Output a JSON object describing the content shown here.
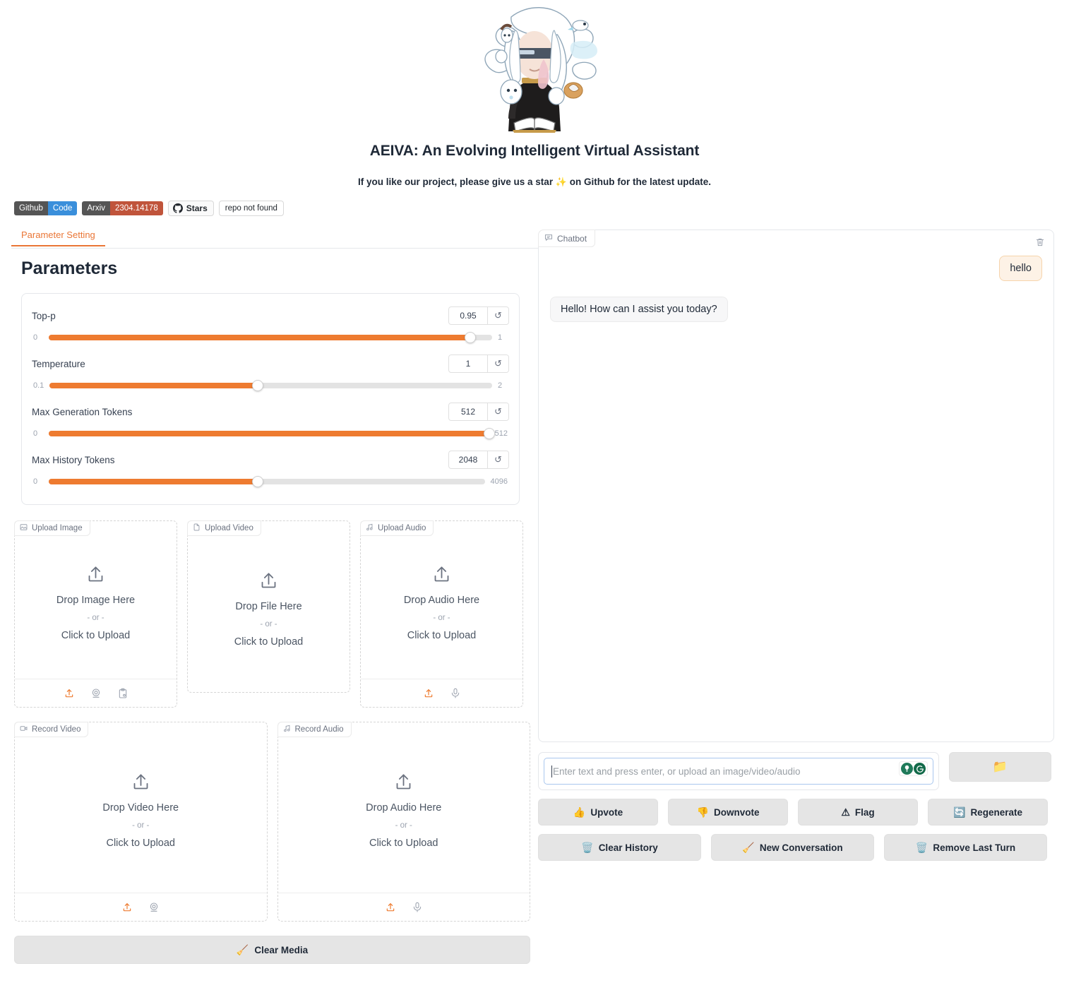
{
  "header": {
    "logo_alt": "aeiva-logo",
    "title": "AEIVA: An Evolving Intelligent Virtual Assistant",
    "subtitle_before": "If you like our project, please give us a star ",
    "subtitle_star": "✨",
    "subtitle_after": " on Github for the latest update."
  },
  "badges": {
    "github_left": "Github",
    "github_right": "Code",
    "arxiv_left": "Arxiv",
    "arxiv_right": "2304.14178",
    "stars_label": "Stars",
    "repo_status": "repo not found"
  },
  "tabs": [
    {
      "label": "Parameter Setting",
      "active": true
    }
  ],
  "parameters": {
    "section_title": "Parameters",
    "rows": [
      {
        "label": "Top-p",
        "value": "0.95",
        "min": "0",
        "max": "1",
        "fill_pct": 95,
        "reset_icon": "↺"
      },
      {
        "label": "Temperature",
        "value": "1",
        "min": "0.1",
        "max": "2",
        "fill_pct": 47,
        "reset_icon": "↺"
      },
      {
        "label": "Max Generation Tokens",
        "value": "512",
        "min": "0",
        "max": "512",
        "fill_pct": 100,
        "reset_icon": "↺"
      },
      {
        "label": "Max History Tokens",
        "value": "2048",
        "min": "0",
        "max": "4096",
        "fill_pct": 48,
        "reset_icon": "↺"
      }
    ]
  },
  "media": {
    "upload_image": {
      "tab_label": "Upload Image",
      "tab_icon": "image-icon",
      "drop_main": "Drop Image Here",
      "or": "- or -",
      "click": "Click to Upload",
      "tools": [
        "upload-icon",
        "webcam-icon",
        "paste-icon"
      ]
    },
    "upload_video": {
      "tab_label": "Upload Video",
      "tab_icon": "file-icon",
      "drop_main": "Drop File Here",
      "or": "- or -",
      "click": "Click to Upload",
      "tools": []
    },
    "upload_audio": {
      "tab_label": "Upload Audio",
      "tab_icon": "music-note-icon",
      "drop_main": "Drop Audio Here",
      "or": "- or -",
      "click": "Click to Upload",
      "tools": [
        "upload-icon",
        "microphone-icon"
      ]
    },
    "record_video": {
      "tab_label": "Record Video",
      "tab_icon": "video-camera-icon",
      "drop_main": "Drop Video Here",
      "or": "- or -",
      "click": "Click to Upload",
      "tools": [
        "upload-icon",
        "webcam-icon"
      ]
    },
    "record_audio": {
      "tab_label": "Record Audio",
      "tab_icon": "music-note-icon",
      "drop_main": "Drop Audio Here",
      "or": "- or -",
      "click": "Click to Upload",
      "tools": [
        "upload-icon",
        "microphone-icon"
      ]
    },
    "clear_media": {
      "emoji": "🧹",
      "label": "Clear Media"
    }
  },
  "chat": {
    "tab_label": "Chatbot",
    "tab_icon": "chat-bubble-icon",
    "trash_icon": "trash-icon",
    "messages": [
      {
        "role": "user",
        "text": "hello"
      },
      {
        "role": "bot",
        "text": "Hello! How can I assist you today?"
      }
    ]
  },
  "input": {
    "placeholder": "Enter text and press enter, or upload an image/video/audio",
    "value": "",
    "assist_icons": [
      "grammarly-suggestion-icon",
      "grammarly-logo-icon"
    ],
    "folder_button_icon": "📁"
  },
  "actions": {
    "row1": [
      {
        "emoji": "👍",
        "label": "Upvote"
      },
      {
        "emoji": "👎",
        "label": "Downvote"
      },
      {
        "emoji": "⚠",
        "label": "Flag"
      },
      {
        "emoji": "🔄",
        "label": "Regenerate"
      }
    ],
    "row2": [
      {
        "emoji": "🗑️",
        "label": "Clear History"
      },
      {
        "emoji": "🧹",
        "label": "New Conversation"
      },
      {
        "emoji": "🗑️",
        "label": "Remove Last Turn"
      }
    ]
  },
  "colors": {
    "accent": "#ee7b30",
    "tab_active": "#ea7636",
    "badge_blue": "#3a8fdb",
    "badge_red": "#c0543b",
    "user_bubble": "#fdf2e6",
    "bot_bubble": "#f7f7f8",
    "button_gray": "#e5e5e5"
  }
}
